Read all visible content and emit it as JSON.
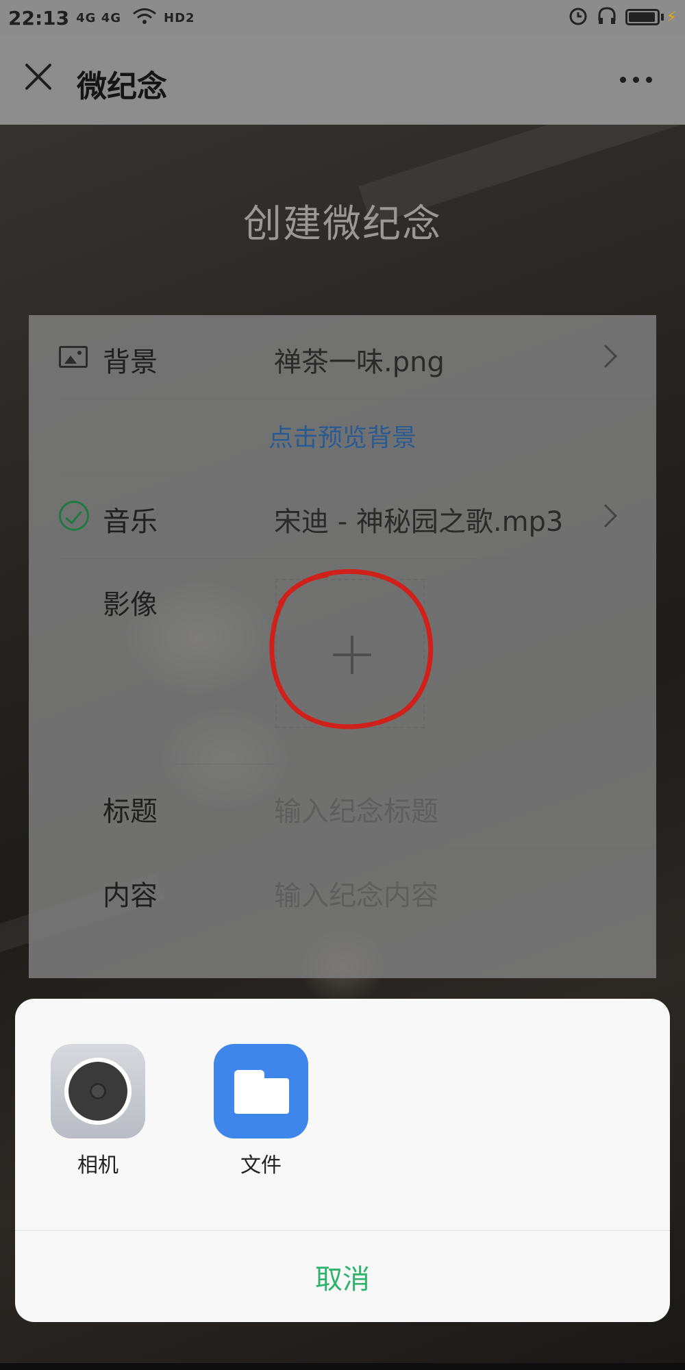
{
  "status_bar": {
    "time": "22:13",
    "signal_text": "4G 4G",
    "hd_text": "HD2"
  },
  "nav": {
    "title": "微纪念"
  },
  "page": {
    "title": "创建微纪念"
  },
  "form": {
    "background": {
      "label": "背景",
      "value": "禅茶一味.png"
    },
    "preview_link": "点击预览背景",
    "music": {
      "label": "音乐",
      "value": "宋迪 - 神秘园之歌.mp3"
    },
    "image": {
      "label": "影像"
    },
    "title_field": {
      "label": "标题",
      "placeholder": "输入纪念标题"
    },
    "content_field": {
      "label": "内容",
      "placeholder": "输入纪念内容"
    }
  },
  "sheet": {
    "apps": [
      {
        "label": "相机",
        "icon": "camera-icon"
      },
      {
        "label": "文件",
        "icon": "folder-icon"
      }
    ],
    "cancel_label": "取消"
  },
  "colors": {
    "link": "#2a5a92",
    "cancel": "#2fb36a",
    "music_check": "#1f7a3f",
    "annotation": "#d0201a"
  }
}
